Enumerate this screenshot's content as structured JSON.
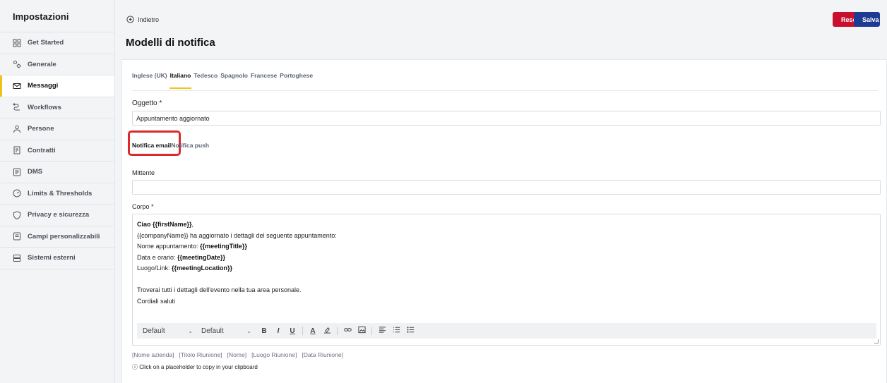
{
  "sidebar": {
    "title": "Impostazioni",
    "items": [
      {
        "label": "Get Started",
        "icon": "grid-icon"
      },
      {
        "label": "Generale",
        "icon": "gears-icon"
      },
      {
        "label": "Messaggi",
        "icon": "mail-icon",
        "active": true
      },
      {
        "label": "Workflows",
        "icon": "workflow-icon"
      },
      {
        "label": "Persone",
        "icon": "user-icon"
      },
      {
        "label": "Contratti",
        "icon": "contract-icon"
      },
      {
        "label": "DMS",
        "icon": "document-icon"
      },
      {
        "label": "Limits & Thresholds",
        "icon": "gauge-icon"
      },
      {
        "label": "Privacy e sicurezza",
        "icon": "shield-icon"
      },
      {
        "label": "Campi personalizzabili",
        "icon": "form-icon"
      },
      {
        "label": "Sistemi esterni",
        "icon": "server-icon"
      }
    ]
  },
  "header": {
    "back_label": "Indietro",
    "reset_label": "Reset",
    "save_label": "Salva",
    "title": "Modelli di notifica"
  },
  "language_tabs": {
    "items": [
      "Inglese (UK)",
      "Italiano",
      "Tedesco",
      "Spagnolo",
      "Francese",
      "Portoghese"
    ],
    "active": "Italiano"
  },
  "subject": {
    "label": "Oggetto *",
    "value": "Appuntamento aggiornato"
  },
  "channel_tabs": {
    "email": "Notifica email",
    "push": "Notifica push",
    "active": "Notifica email"
  },
  "sender": {
    "label": "Mittente",
    "value": ""
  },
  "body": {
    "label": "Corpo *",
    "lines": {
      "l1_prefix": "Ciao ",
      "l1_var": "{{firstName}}",
      "l1_suffix": ",",
      "l2": "{{companyName}} ha aggiornato i dettagli del seguente appuntamento:",
      "l3_prefix": "Nome appuntamento: ",
      "l3_var": "{{meetingTitle}}",
      "l4_prefix": "Data e orario: ",
      "l4_var": "{{meetingDate}}",
      "l5_prefix": "Luogo/Link: ",
      "l5_var": "{{meetingLocation}}",
      "l6": "Troverai tutti i dettagli dell'evento nella tua area personale.",
      "l7": "Cordiali saluti"
    },
    "toolbar": {
      "font_family": "Default",
      "font_size": "Default",
      "bold": "B",
      "italic": "I",
      "underline": "U",
      "text_color": "A"
    }
  },
  "placeholders": {
    "items": [
      "[Nome azienda]",
      "[Titolo Riunione]",
      "[Nome]",
      "[Luogo Riunione]",
      "[Data Riunione]"
    ],
    "hint": "ⓘ Click on a placeholder to copy in your clipboard"
  },
  "colors": {
    "accent": "#f1c21b",
    "reset": "#c8102e",
    "save": "#1f3a93",
    "highlight": "#d92b2b"
  }
}
